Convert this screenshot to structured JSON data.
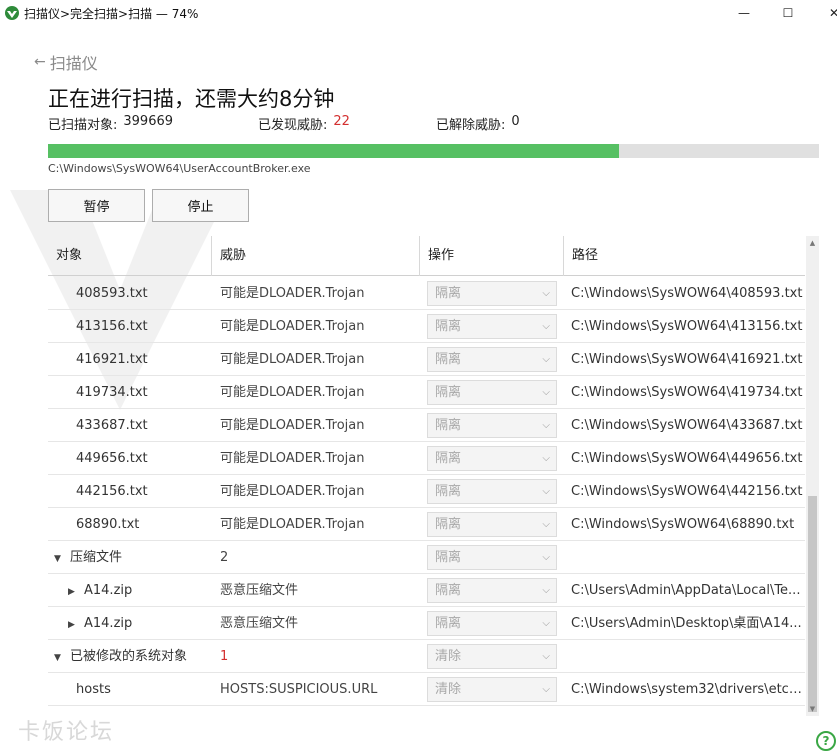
{
  "window": {
    "title": "扫描仪>完全扫描>扫描 — 74%",
    "minimize_glyph": "—",
    "maximize_glyph": "☐",
    "close_glyph": "✕"
  },
  "nav": {
    "back_label": "扫描仪"
  },
  "page": {
    "title": "正在进行扫描，还需大约8分钟"
  },
  "stats": {
    "scanned_label": "已扫描对象:",
    "scanned_value": "399669",
    "found_label": "已发现威胁:",
    "found_value": "22",
    "resolved_label": "已解除威胁:",
    "resolved_value": "0"
  },
  "progress": {
    "percent": 74,
    "current_file": "C:\\Windows\\SysWOW64\\UserAccountBroker.exe"
  },
  "buttons": {
    "pause": "暂停",
    "stop": "停止"
  },
  "table": {
    "headers": [
      "对象",
      "威胁",
      "操作",
      "路径"
    ],
    "rows": [
      {
        "object": "408593.txt",
        "threat": "可能是DLOADER.Trojan",
        "action": "隔离",
        "path": "C:\\Windows\\SysWOW64\\408593.txt"
      },
      {
        "object": "413156.txt",
        "threat": "可能是DLOADER.Trojan",
        "action": "隔离",
        "path": "C:\\Windows\\SysWOW64\\413156.txt"
      },
      {
        "object": "416921.txt",
        "threat": "可能是DLOADER.Trojan",
        "action": "隔离",
        "path": "C:\\Windows\\SysWOW64\\416921.txt"
      },
      {
        "object": "419734.txt",
        "threat": "可能是DLOADER.Trojan",
        "action": "隔离",
        "path": "C:\\Windows\\SysWOW64\\419734.txt"
      },
      {
        "object": "433687.txt",
        "threat": "可能是DLOADER.Trojan",
        "action": "隔离",
        "path": "C:\\Windows\\SysWOW64\\433687.txt"
      },
      {
        "object": "449656.txt",
        "threat": "可能是DLOADER.Trojan",
        "action": "隔离",
        "path": "C:\\Windows\\SysWOW64\\449656.txt"
      },
      {
        "object": "442156.txt",
        "threat": "可能是DLOADER.Trojan",
        "action": "隔离",
        "path": "C:\\Windows\\SysWOW64\\442156.txt"
      },
      {
        "object": "68890.txt",
        "threat": "可能是DLOADER.Trojan",
        "action": "隔离",
        "path": "C:\\Windows\\SysWOW64\\68890.txt"
      },
      {
        "object": "压缩文件",
        "threat": "2",
        "action": "隔离",
        "path": ""
      },
      {
        "object": "A14.zip",
        "threat": "恶意压缩文件",
        "action": "隔离",
        "path": "C:\\Users\\Admin\\AppData\\Local\\Te..."
      },
      {
        "object": "A14.zip",
        "threat": "恶意压缩文件",
        "action": "隔离",
        "path": "C:\\Users\\Admin\\Desktop\\桌面\\A14..."
      },
      {
        "object": "已被修改的系统对象",
        "threat": "1",
        "action": "清除",
        "path": ""
      },
      {
        "object": "hosts",
        "threat": "HOSTS:SUSPICIOUS.URL",
        "action": "清除",
        "path": "C:\\Windows\\system32\\drivers\\etc\\..."
      }
    ]
  },
  "footer": {
    "watermark": "卡饭论坛",
    "help_glyph": "?"
  }
}
